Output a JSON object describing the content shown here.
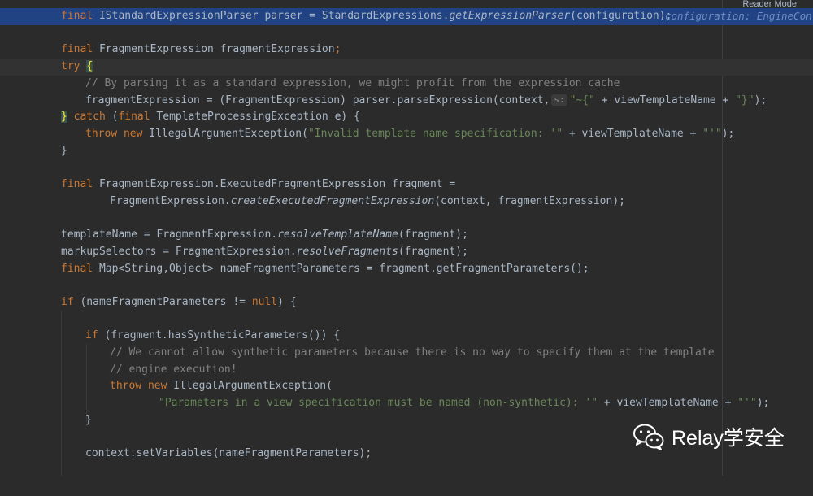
{
  "toolbar": {
    "reader_mode": "Reader Mode"
  },
  "code": {
    "l1": {
      "final": "final",
      "a": " IStandardExpressionParser parser = StandardExpressions.",
      "m": "getExpressionParser",
      "b": "(configuration);",
      "hint": "configuration: EngineCon"
    },
    "l3": {
      "final": "final",
      "a": " FragmentExpression fragmentExpression",
      "semi": ";"
    },
    "l4": {
      "try": "try",
      "sp": " ",
      "brace": "{"
    },
    "l5": {
      "comment": "// By parsing it as a standard expression, we might profit from the expression cache"
    },
    "l6": {
      "a": "fragmentExpression = (FragmentExpression) parser.parseExpression(context,",
      "param": "s:",
      "str1": "\"~{\"",
      "b": " + viewTemplateName + ",
      "str2": "\"}\"",
      "c": ");"
    },
    "l7": {
      "brace": "}",
      "catch": " catch",
      "a": " (",
      "final": "final",
      "b": " TemplateProcessingException e) {"
    },
    "l8": {
      "throw": "throw",
      "new": " new",
      "a": " IllegalArgumentException(",
      "str1": "\"Invalid template name specification: '\"",
      "b": " + viewTemplateName + ",
      "str2": "\"'\"",
      "c": ");"
    },
    "l9": {
      "a": "}"
    },
    "l11": {
      "final": "final",
      "a": " FragmentExpression.ExecutedFragmentExpression fragment ="
    },
    "l12": {
      "a": "FragmentExpression.",
      "m": "createExecutedFragmentExpression",
      "b": "(context, fragmentExpression);"
    },
    "l14": {
      "a": "templateName = FragmentExpression.",
      "m": "resolveTemplateName",
      "b": "(fragment);"
    },
    "l15": {
      "a": "markupSelectors = FragmentExpression.",
      "m": "resolveFragments",
      "b": "(fragment);"
    },
    "l16": {
      "final": "final",
      "a": " Map<String,Object> nameFragmentParameters = fragment.getFragmentParameters();"
    },
    "l18": {
      "if": "if",
      "a": " (nameFragmentParameters != ",
      "null": "null",
      "b": ") {"
    },
    "l20": {
      "if": "if",
      "a": " (fragment.hasSyntheticParameters()) {"
    },
    "l21": {
      "comment": "// We cannot allow synthetic parameters because there is no way to specify them at the template"
    },
    "l22": {
      "comment": "// engine execution!"
    },
    "l23": {
      "throw": "throw",
      "new": " new",
      "a": " IllegalArgumentException("
    },
    "l24": {
      "str1": "\"Parameters in a view specification must be named (non-synthetic): '\"",
      "b": " + viewTemplateName + ",
      "str2": "\"'\"",
      "c": ");"
    },
    "l25": {
      "a": "}"
    },
    "l27": {
      "a": "context.setVariables(nameFragmentParameters);"
    }
  },
  "watermark": {
    "text": "Relay学安全",
    "icon": "wechat-icon"
  }
}
